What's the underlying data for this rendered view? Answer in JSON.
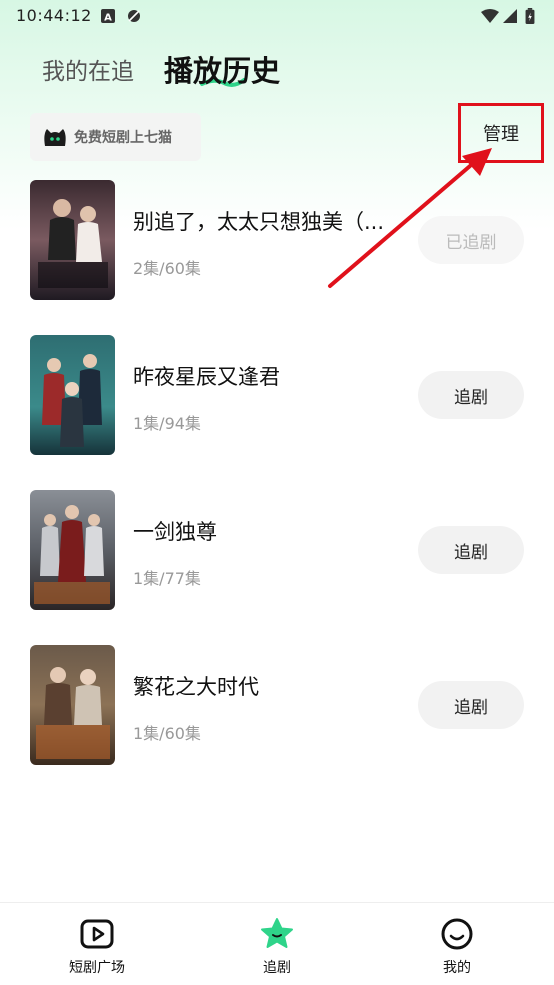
{
  "status_bar": {
    "time": "10:44:12",
    "icons": [
      "a-box-icon",
      "notification-icon",
      "wifi-icon",
      "signal-icon",
      "battery-icon"
    ]
  },
  "tabs": {
    "following": "我的在追",
    "history": "播放历史"
  },
  "promo": {
    "text": "免费短剧上七猫",
    "icon": "cat-logo-icon"
  },
  "manage_label": "管理",
  "items": [
    {
      "title": "别追了，太太只想独美（...",
      "episodes": "2集/60集",
      "button": "已追剧",
      "followed": true
    },
    {
      "title": "昨夜星辰又逢君",
      "episodes": "1集/94集",
      "button": "追剧",
      "followed": false
    },
    {
      "title": "一剑独尊",
      "episodes": "1集/77集",
      "button": "追剧",
      "followed": false
    },
    {
      "title": "繁花之大时代",
      "episodes": "1集/60集",
      "button": "追剧",
      "followed": false
    }
  ],
  "bottom_nav": [
    {
      "label": "短剧广场",
      "icon": "play-square-icon"
    },
    {
      "label": "追剧",
      "icon": "star-icon",
      "active": true
    },
    {
      "label": "我的",
      "icon": "smile-face-icon"
    }
  ],
  "colors": {
    "accent": "#2fd48a",
    "highlight_box": "#e0111b",
    "gradient_top": "#d7f7e4"
  }
}
